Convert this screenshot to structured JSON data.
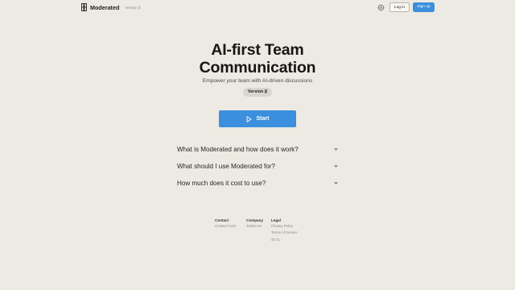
{
  "header": {
    "brand_name": "Moderated",
    "brand_version": "Version β",
    "login_label": "Log in",
    "signup_label": "Sign up"
  },
  "hero": {
    "title_line1": "AI-first Team",
    "title_line2": "Communication",
    "subtitle": "Empower your team with AI-driven discussions",
    "version_badge": "Version β",
    "start_label": "Start"
  },
  "faq": [
    {
      "question": "What is Moderated and how does it work?"
    },
    {
      "question": "What should I use Moderated for?"
    },
    {
      "question": "How much does it cost to use?"
    }
  ],
  "footer": {
    "contact": {
      "heading": "Contact",
      "links": [
        "Contact Form"
      ]
    },
    "company": {
      "heading": "Company",
      "links": [
        "Tokela Inc"
      ]
    },
    "legal": {
      "heading": "Legal",
      "links": [
        "Privacy Policy",
        "Terms of Service",
        "SCTL"
      ]
    }
  },
  "colors": {
    "background": "#eceae2",
    "accent": "#3b8fdc",
    "badge": "#d8d6cf"
  },
  "icons": {
    "brand": "moderated-logo-icon",
    "settings": "gear-icon",
    "start": "play-icon",
    "faq": "chevron-down-icon"
  }
}
